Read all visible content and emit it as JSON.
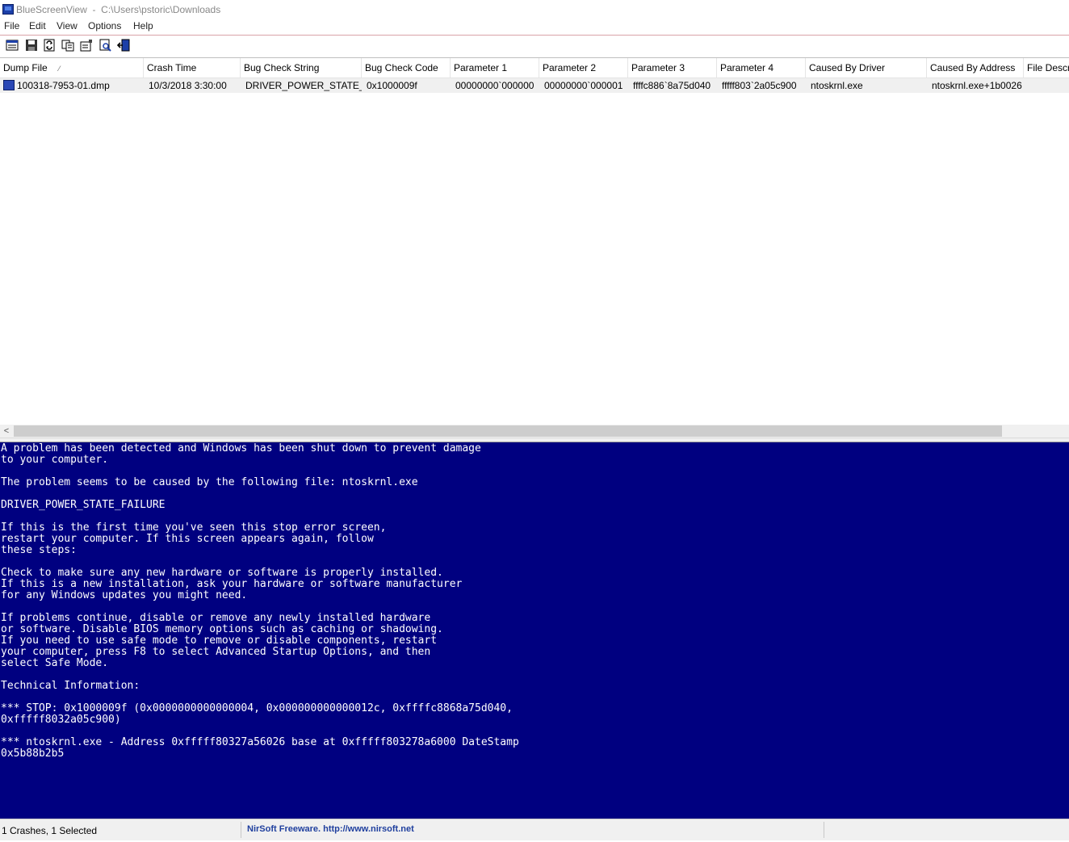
{
  "window": {
    "title": "BlueScreenView  -  C:\\Users\\pstoric\\Downloads"
  },
  "menu": [
    "File",
    "Edit",
    "View",
    "Options",
    "Help"
  ],
  "toolbar": {
    "buttons": [
      "html-report-icon",
      "save-icon",
      "refresh-icon",
      "copy-icon",
      "properties-icon",
      "find-icon",
      "exit-icon"
    ]
  },
  "table": {
    "columns": [
      "Dump File",
      "Crash Time",
      "Bug Check String",
      "Bug Check Code",
      "Parameter 1",
      "Parameter 2",
      "Parameter 3",
      "Parameter 4",
      "Caused By Driver",
      "Caused By Address",
      "File Descr"
    ],
    "sort_arrow": "⁄",
    "rows": [
      [
        "100318-7953-01.dmp",
        "10/3/2018 3:30:00",
        "DRIVER_POWER_STATE_...",
        "0x1000009f",
        "00000000`000000",
        "00000000`000001",
        "ffffc886`8a75d040",
        "fffff803`2a05c900",
        "ntoskrnl.exe",
        "ntoskrnl.exe+1b0026",
        ""
      ]
    ]
  },
  "scrollbar": {
    "left_arrow": "<"
  },
  "bsod": {
    "text": "A problem has been detected and Windows has been shut down to prevent damage\nto your computer.\n\nThe problem seems to be caused by the following file: ntoskrnl.exe\n\nDRIVER_POWER_STATE_FAILURE\n\nIf this is the first time you've seen this stop error screen,\nrestart your computer. If this screen appears again, follow\nthese steps:\n\nCheck to make sure any new hardware or software is properly installed.\nIf this is a new installation, ask your hardware or software manufacturer\nfor any Windows updates you might need.\n\nIf problems continue, disable or remove any newly installed hardware\nor software. Disable BIOS memory options such as caching or shadowing.\nIf you need to use safe mode to remove or disable components, restart\nyour computer, press F8 to select Advanced Startup Options, and then\nselect Safe Mode.\n\nTechnical Information:\n\n*** STOP: 0x1000009f (0x0000000000000004, 0x000000000000012c, 0xffffc8868a75d040,\n0xfffff8032a05c900)\n\n*** ntoskrnl.exe - Address 0xfffff80327a56026 base at 0xfffff803278a6000 DateStamp\n0x5b88b2b5"
  },
  "status": {
    "count": "1 Crashes, 1 Selected",
    "link": "NirSoft Freeware.  http://www.nirsoft.net"
  },
  "colors": {
    "bsod_background": "#000080",
    "bsod_text": "#ffffff",
    "selected_row": "#f0f0f0",
    "link": "#1f3f9e"
  }
}
